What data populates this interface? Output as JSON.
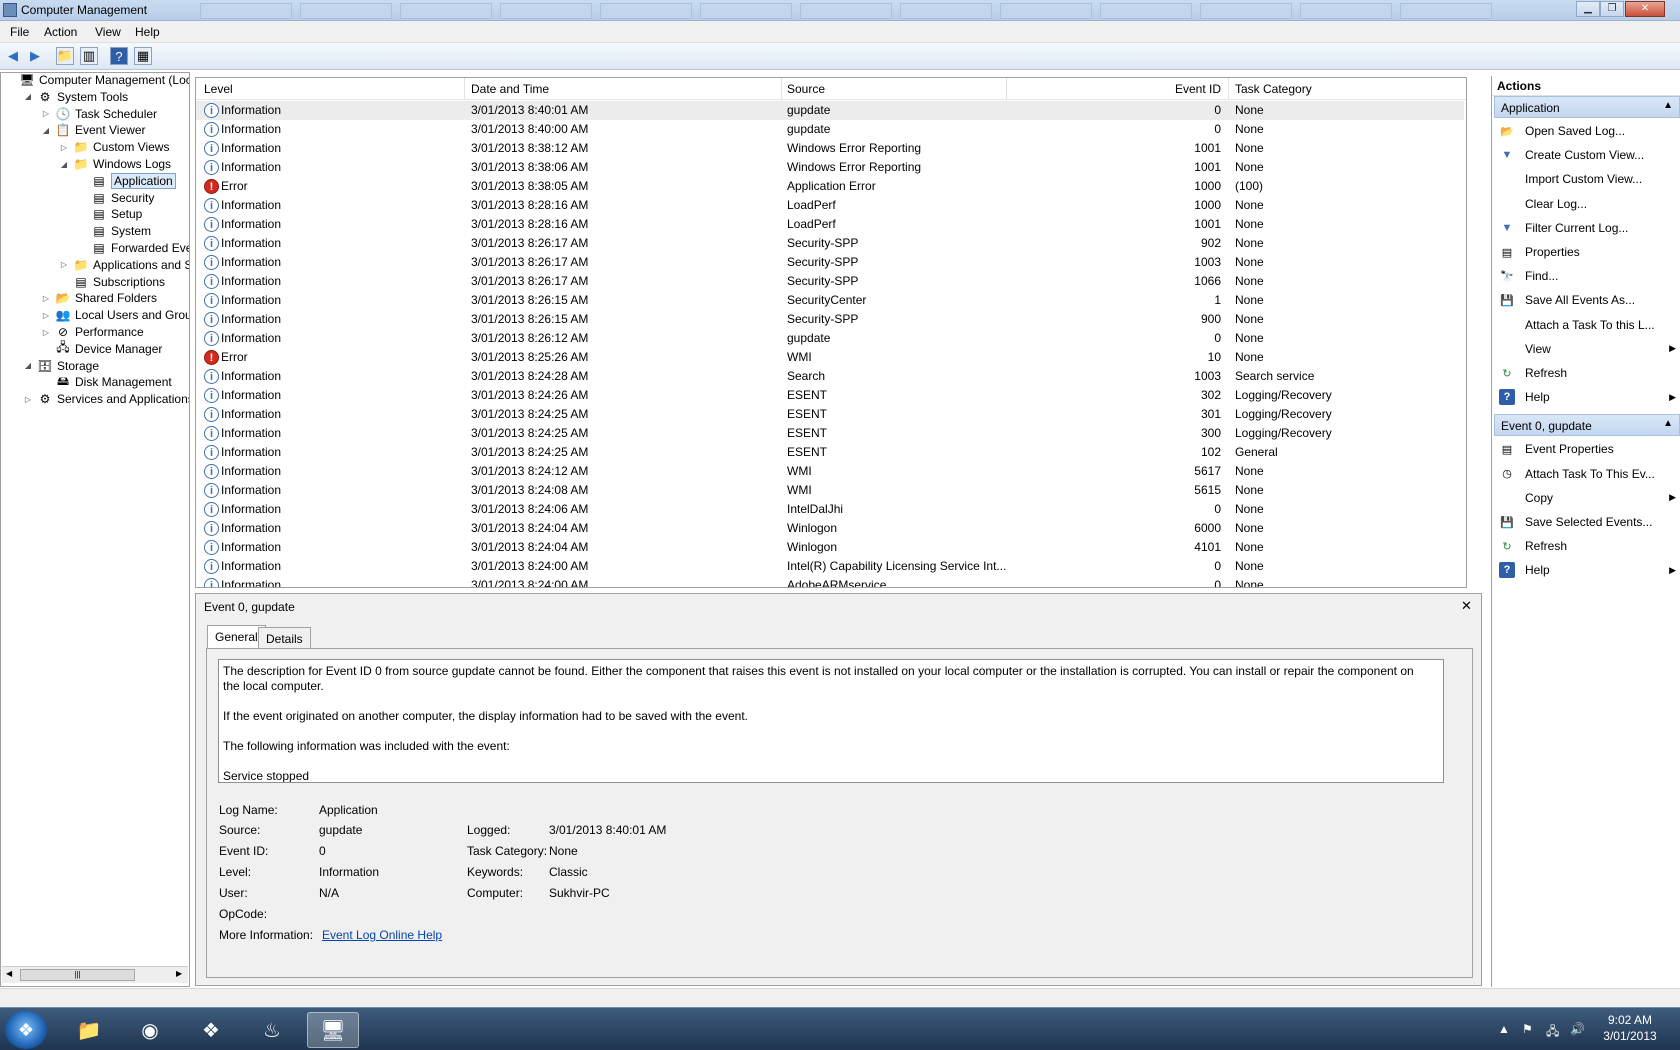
{
  "window": {
    "title": "Computer Management"
  },
  "menu": [
    "File",
    "Action",
    "View",
    "Help"
  ],
  "tree": [
    {
      "label": "Computer Management (Local",
      "level": 0,
      "exp": "",
      "icon": "computer-icon",
      "glyph": "🖥"
    },
    {
      "label": "System Tools",
      "level": 1,
      "exp": "◢",
      "icon": "tools-icon",
      "glyph": "⚙"
    },
    {
      "label": "Task Scheduler",
      "level": 2,
      "exp": "▷",
      "icon": "clock-icon",
      "glyph": "🕓"
    },
    {
      "label": "Event Viewer",
      "level": 2,
      "exp": "◢",
      "icon": "event-viewer-icon",
      "glyph": "📋"
    },
    {
      "label": "Custom Views",
      "level": 3,
      "exp": "▷",
      "icon": "folder-icon",
      "glyph": "📁"
    },
    {
      "label": "Windows Logs",
      "level": 3,
      "exp": "◢",
      "icon": "folder-icon",
      "glyph": "📁"
    },
    {
      "label": "Application",
      "level": 4,
      "exp": "",
      "icon": "log-icon",
      "glyph": "▤",
      "selected": true
    },
    {
      "label": "Security",
      "level": 4,
      "exp": "",
      "icon": "log-icon",
      "glyph": "▤"
    },
    {
      "label": "Setup",
      "level": 4,
      "exp": "",
      "icon": "log-icon",
      "glyph": "▤"
    },
    {
      "label": "System",
      "level": 4,
      "exp": "",
      "icon": "log-icon",
      "glyph": "▤"
    },
    {
      "label": "Forwarded Event",
      "level": 4,
      "exp": "",
      "icon": "log-icon",
      "glyph": "▤"
    },
    {
      "label": "Applications and Se",
      "level": 3,
      "exp": "▷",
      "icon": "folder-icon",
      "glyph": "📁"
    },
    {
      "label": "Subscriptions",
      "level": 3,
      "exp": "",
      "icon": "subscriptions-icon",
      "glyph": "▤"
    },
    {
      "label": "Shared Folders",
      "level": 2,
      "exp": "▷",
      "icon": "shared-folder-icon",
      "glyph": "📂"
    },
    {
      "label": "Local Users and Groups",
      "level": 2,
      "exp": "▷",
      "icon": "users-icon",
      "glyph": "👥"
    },
    {
      "label": "Performance",
      "level": 2,
      "exp": "▷",
      "icon": "performance-icon",
      "glyph": "⊘"
    },
    {
      "label": "Device Manager",
      "level": 2,
      "exp": "",
      "icon": "device-manager-icon",
      "glyph": "🖧"
    },
    {
      "label": "Storage",
      "level": 1,
      "exp": "◢",
      "icon": "storage-icon",
      "glyph": "🗄"
    },
    {
      "label": "Disk Management",
      "level": 2,
      "exp": "",
      "icon": "disk-icon",
      "glyph": "🖴"
    },
    {
      "label": "Services and Applications",
      "level": 1,
      "exp": "▷",
      "icon": "services-icon",
      "glyph": "⚙"
    }
  ],
  "events": {
    "columns": {
      "level": "Level",
      "datetime": "Date and Time",
      "source": "Source",
      "eventid": "Event ID",
      "category": "Task Category"
    },
    "rows": [
      {
        "level": "Information",
        "datetime": "3/01/2013 8:40:01 AM",
        "source": "gupdate",
        "eventid": "0",
        "category": "None"
      },
      {
        "level": "Information",
        "datetime": "3/01/2013 8:40:00 AM",
        "source": "gupdate",
        "eventid": "0",
        "category": "None"
      },
      {
        "level": "Information",
        "datetime": "3/01/2013 8:38:12 AM",
        "source": "Windows Error Reporting",
        "eventid": "1001",
        "category": "None"
      },
      {
        "level": "Information",
        "datetime": "3/01/2013 8:38:06 AM",
        "source": "Windows Error Reporting",
        "eventid": "1001",
        "category": "None"
      },
      {
        "level": "Error",
        "datetime": "3/01/2013 8:38:05 AM",
        "source": "Application Error",
        "eventid": "1000",
        "category": "(100)"
      },
      {
        "level": "Information",
        "datetime": "3/01/2013 8:28:16 AM",
        "source": "LoadPerf",
        "eventid": "1000",
        "category": "None"
      },
      {
        "level": "Information",
        "datetime": "3/01/2013 8:28:16 AM",
        "source": "LoadPerf",
        "eventid": "1001",
        "category": "None"
      },
      {
        "level": "Information",
        "datetime": "3/01/2013 8:26:17 AM",
        "source": "Security-SPP",
        "eventid": "902",
        "category": "None"
      },
      {
        "level": "Information",
        "datetime": "3/01/2013 8:26:17 AM",
        "source": "Security-SPP",
        "eventid": "1003",
        "category": "None"
      },
      {
        "level": "Information",
        "datetime": "3/01/2013 8:26:17 AM",
        "source": "Security-SPP",
        "eventid": "1066",
        "category": "None"
      },
      {
        "level": "Information",
        "datetime": "3/01/2013 8:26:15 AM",
        "source": "SecurityCenter",
        "eventid": "1",
        "category": "None"
      },
      {
        "level": "Information",
        "datetime": "3/01/2013 8:26:15 AM",
        "source": "Security-SPP",
        "eventid": "900",
        "category": "None"
      },
      {
        "level": "Information",
        "datetime": "3/01/2013 8:26:12 AM",
        "source": "gupdate",
        "eventid": "0",
        "category": "None"
      },
      {
        "level": "Error",
        "datetime": "3/01/2013 8:25:26 AM",
        "source": "WMI",
        "eventid": "10",
        "category": "None"
      },
      {
        "level": "Information",
        "datetime": "3/01/2013 8:24:28 AM",
        "source": "Search",
        "eventid": "1003",
        "category": "Search service"
      },
      {
        "level": "Information",
        "datetime": "3/01/2013 8:24:26 AM",
        "source": "ESENT",
        "eventid": "302",
        "category": "Logging/Recovery"
      },
      {
        "level": "Information",
        "datetime": "3/01/2013 8:24:25 AM",
        "source": "ESENT",
        "eventid": "301",
        "category": "Logging/Recovery"
      },
      {
        "level": "Information",
        "datetime": "3/01/2013 8:24:25 AM",
        "source": "ESENT",
        "eventid": "300",
        "category": "Logging/Recovery"
      },
      {
        "level": "Information",
        "datetime": "3/01/2013 8:24:25 AM",
        "source": "ESENT",
        "eventid": "102",
        "category": "General"
      },
      {
        "level": "Information",
        "datetime": "3/01/2013 8:24:12 AM",
        "source": "WMI",
        "eventid": "5617",
        "category": "None"
      },
      {
        "level": "Information",
        "datetime": "3/01/2013 8:24:08 AM",
        "source": "WMI",
        "eventid": "5615",
        "category": "None"
      },
      {
        "level": "Information",
        "datetime": "3/01/2013 8:24:06 AM",
        "source": "IntelDalJhi",
        "eventid": "0",
        "category": "None"
      },
      {
        "level": "Information",
        "datetime": "3/01/2013 8:24:04 AM",
        "source": "Winlogon",
        "eventid": "6000",
        "category": "None"
      },
      {
        "level": "Information",
        "datetime": "3/01/2013 8:24:04 AM",
        "source": "Winlogon",
        "eventid": "4101",
        "category": "None"
      },
      {
        "level": "Information",
        "datetime": "3/01/2013 8:24:00 AM",
        "source": "Intel(R) Capability Licensing Service Int...",
        "eventid": "0",
        "category": "None"
      },
      {
        "level": "Information",
        "datetime": "3/01/2013 8:24:00 AM",
        "source": "AdobeARMservice",
        "eventid": "0",
        "category": "None"
      }
    ]
  },
  "detail": {
    "header": "Event 0, gupdate",
    "close_glyph": "✕",
    "tabs": [
      "General",
      "Details"
    ],
    "description": [
      "The description for Event ID 0 from source gupdate cannot be found. Either the component that raises this event is not installed on your local computer or the installation is corrupted. You can install or repair the component on the local computer.",
      "If the event originated on another computer, the display information had to be saved with the event.",
      "The following information was included with the event:",
      "Service stopped"
    ],
    "labels": {
      "log_name": "Log Name:",
      "source": "Source:",
      "event_id": "Event ID:",
      "level": "Level:",
      "user": "User:",
      "opcode": "OpCode:",
      "more_info": "More Information:",
      "logged": "Logged:",
      "task_category": "Task Category:",
      "keywords": "Keywords:",
      "computer": "Computer:"
    },
    "values": {
      "log_name": "Application",
      "source": "gupdate",
      "event_id": "0",
      "level": "Information",
      "user": "N/A",
      "opcode": "",
      "more_info": "Event Log Online Help",
      "logged": "3/01/2013 8:40:01 AM",
      "task_category": "None",
      "keywords": "Classic",
      "computer": "Sukhvir-PC"
    }
  },
  "actions": {
    "title": "Actions",
    "sections": [
      {
        "header": "Application",
        "items": [
          {
            "label": "Open Saved Log...",
            "icon": "open-folder-icon",
            "glyph": "📂"
          },
          {
            "label": "Create Custom View...",
            "icon": "filter-icon",
            "glyph": "▼"
          },
          {
            "label": "Import Custom View...",
            "icon": "",
            "glyph": ""
          },
          {
            "label": "Clear Log...",
            "icon": "",
            "glyph": ""
          },
          {
            "label": "Filter Current Log...",
            "icon": "filter-icon",
            "glyph": "▼"
          },
          {
            "label": "Properties",
            "icon": "properties-icon",
            "glyph": "▤"
          },
          {
            "label": "Find...",
            "icon": "binoculars-icon",
            "glyph": "🔭"
          },
          {
            "label": "Save All Events As...",
            "icon": "save-icon",
            "glyph": "💾"
          },
          {
            "label": "Attach a Task To this L...",
            "icon": "",
            "glyph": ""
          },
          {
            "label": "View",
            "icon": "",
            "glyph": "",
            "submenu": true
          },
          {
            "label": "Refresh",
            "icon": "refresh-icon",
            "glyph": "↻"
          },
          {
            "label": "Help",
            "icon": "help-icon",
            "glyph": "?",
            "submenu": true
          }
        ]
      },
      {
        "header": "Event 0, gupdate",
        "items": [
          {
            "label": "Event Properties",
            "icon": "properties-icon",
            "glyph": "▤"
          },
          {
            "label": "Attach Task To This Ev...",
            "icon": "task-icon",
            "glyph": "◷"
          },
          {
            "label": "Copy",
            "icon": "",
            "glyph": "",
            "submenu": true
          },
          {
            "label": "Save Selected Events...",
            "icon": "save-icon",
            "glyph": "💾"
          },
          {
            "label": "Refresh",
            "icon": "refresh-icon",
            "glyph": "↻"
          },
          {
            "label": "Help",
            "icon": "help-icon",
            "glyph": "?",
            "submenu": true
          }
        ]
      }
    ]
  },
  "taskbar": {
    "apps": [
      {
        "name": "explorer",
        "icon": "folder-icon",
        "glyph": "📁"
      },
      {
        "name": "chrome",
        "icon": "chrome-icon",
        "glyph": "◉"
      },
      {
        "name": "dropbox",
        "icon": "dropbox-icon",
        "glyph": "❖"
      },
      {
        "name": "steam",
        "icon": "steam-icon",
        "glyph": "♨"
      },
      {
        "name": "computer-management",
        "icon": "computer-management-icon",
        "glyph": "🖥",
        "active": true
      }
    ],
    "clock": {
      "time": "9:02 AM",
      "date": "3/01/2013"
    }
  },
  "colors": {
    "selection": "#dbeaf9",
    "section_header": "#c3d7ef",
    "error": "#d42a1c",
    "info": "#3f6fae",
    "link": "#0645ad"
  }
}
